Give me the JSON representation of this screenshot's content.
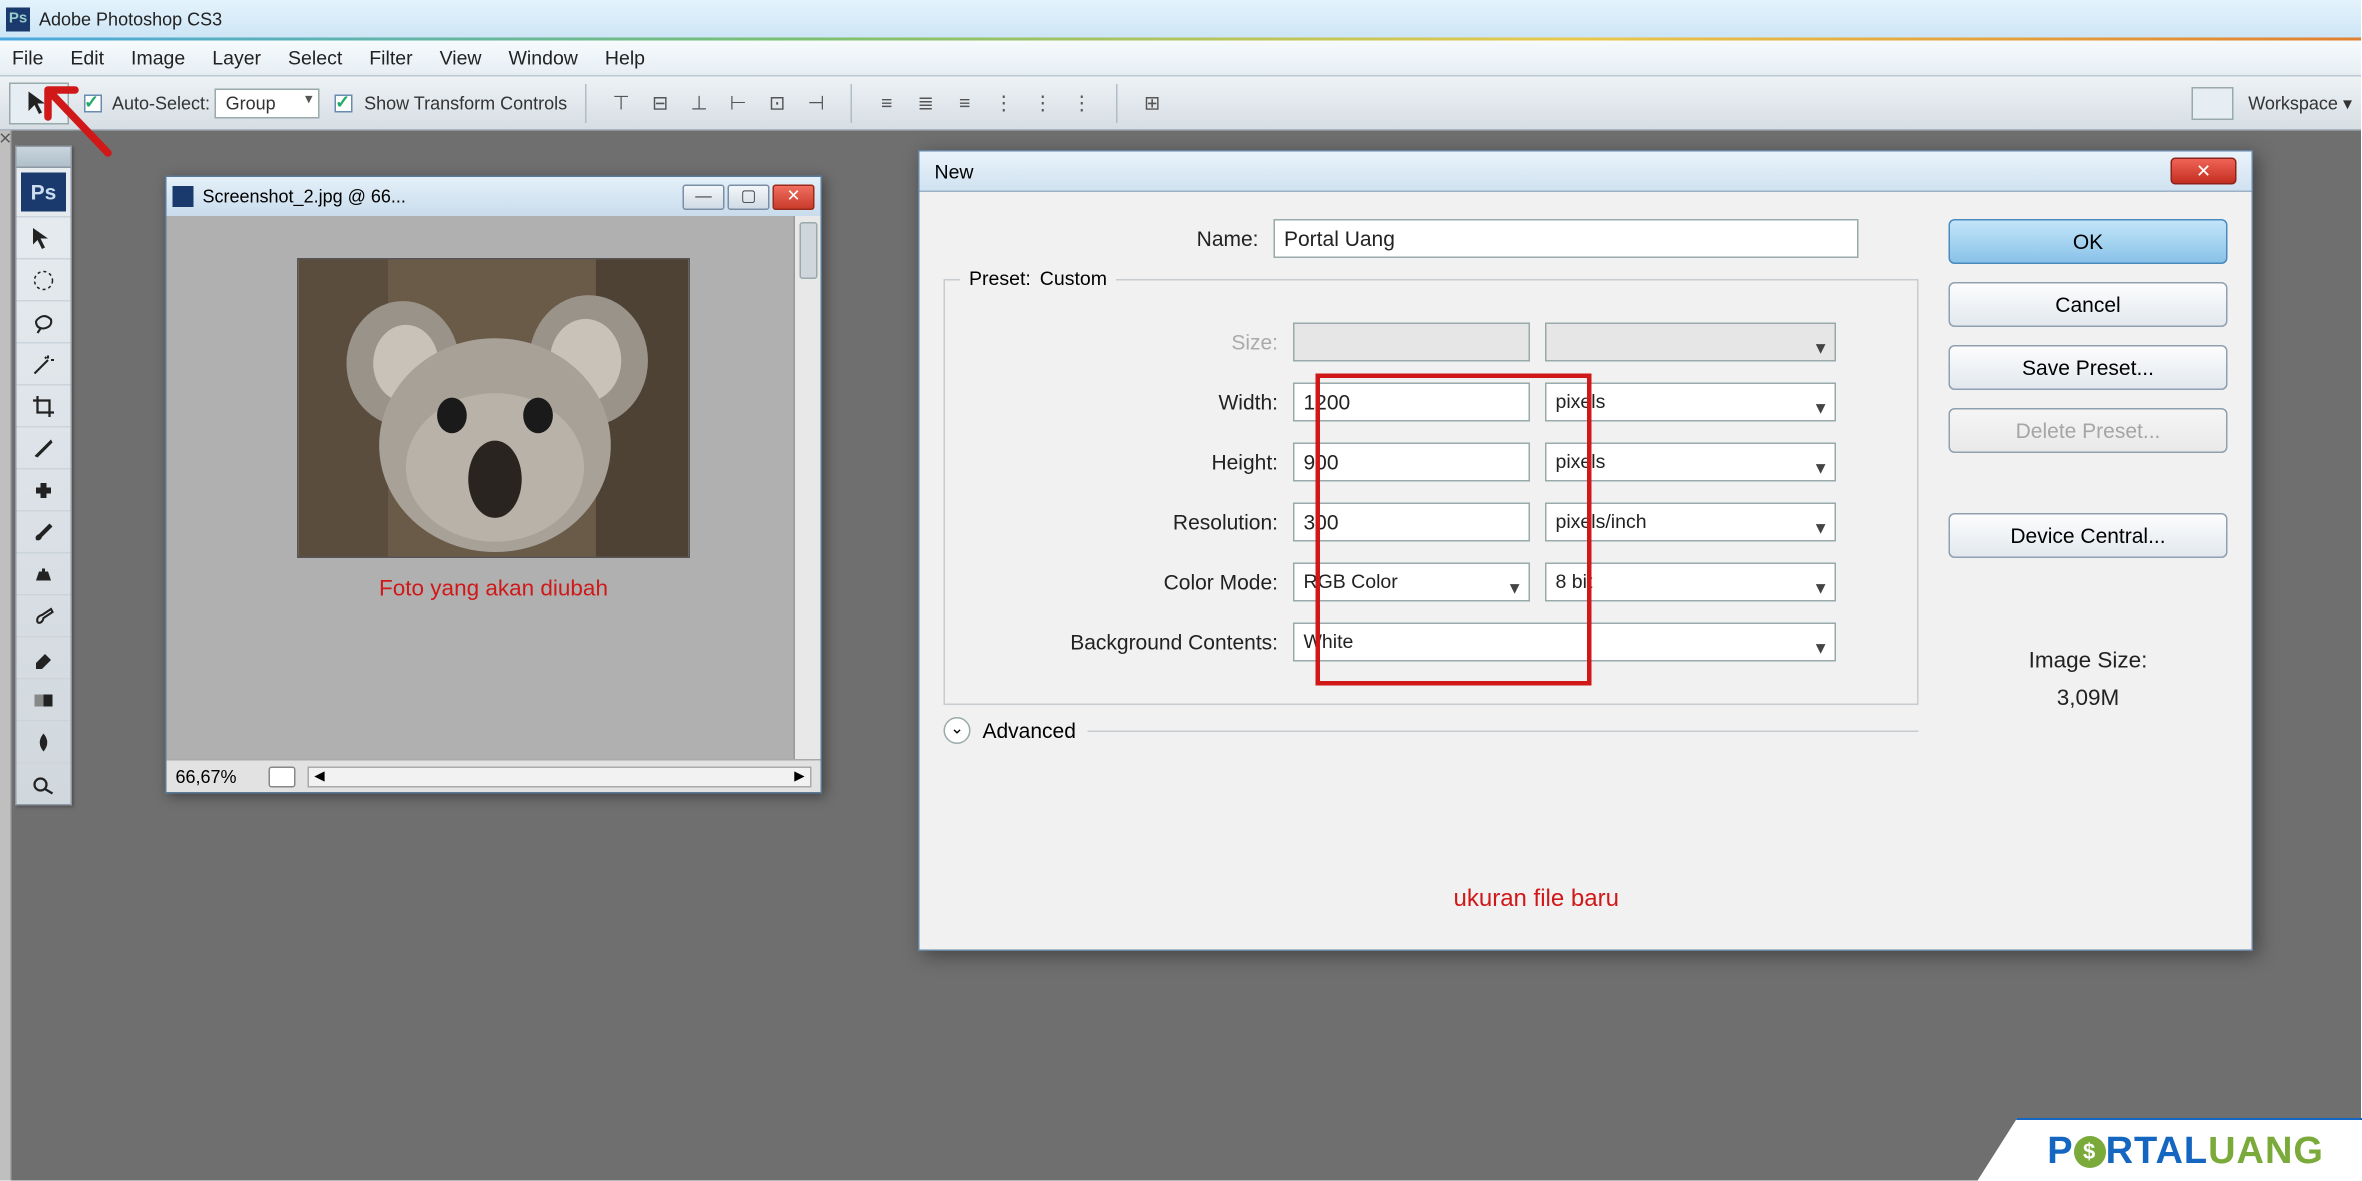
{
  "title": "Adobe Photoshop CS3",
  "menu": [
    "File",
    "Edit",
    "Image",
    "Layer",
    "Select",
    "Filter",
    "View",
    "Window",
    "Help"
  ],
  "optbar": {
    "auto_select": "Auto-Select:",
    "auto_select_value": "Group",
    "show_transform": "Show Transform Controls",
    "workspace": "Workspace ▾"
  },
  "docwin": {
    "title": "Screenshot_2.jpg @ 66...",
    "caption": "Foto yang akan diubah",
    "zoom": "66,67%"
  },
  "dialog": {
    "title": "New",
    "name_label": "Name:",
    "name_value": "Portal Uang",
    "preset_label": "Preset:",
    "preset_value": "Custom",
    "size_label": "Size:",
    "width_label": "Width:",
    "width_value": "1200",
    "width_unit": "pixels",
    "height_label": "Height:",
    "height_value": "900",
    "height_unit": "pixels",
    "res_label": "Resolution:",
    "res_value": "300",
    "res_unit": "pixels/inch",
    "mode_label": "Color Mode:",
    "mode_value": "RGB Color",
    "depth_value": "8 bit",
    "bg_label": "Background Contents:",
    "bg_value": "White",
    "advanced": "Advanced",
    "annotation": "ukuran file baru",
    "img_size_label": "Image Size:",
    "img_size_value": "3,09M",
    "btn_ok": "OK",
    "btn_cancel": "Cancel",
    "btn_save": "Save Preset...",
    "btn_delete": "Delete Preset...",
    "btn_device": "Device Central..."
  },
  "watermark": {
    "p": "P",
    "rtal": "RTAL",
    "uang": "UANG",
    "dollar": "$"
  }
}
